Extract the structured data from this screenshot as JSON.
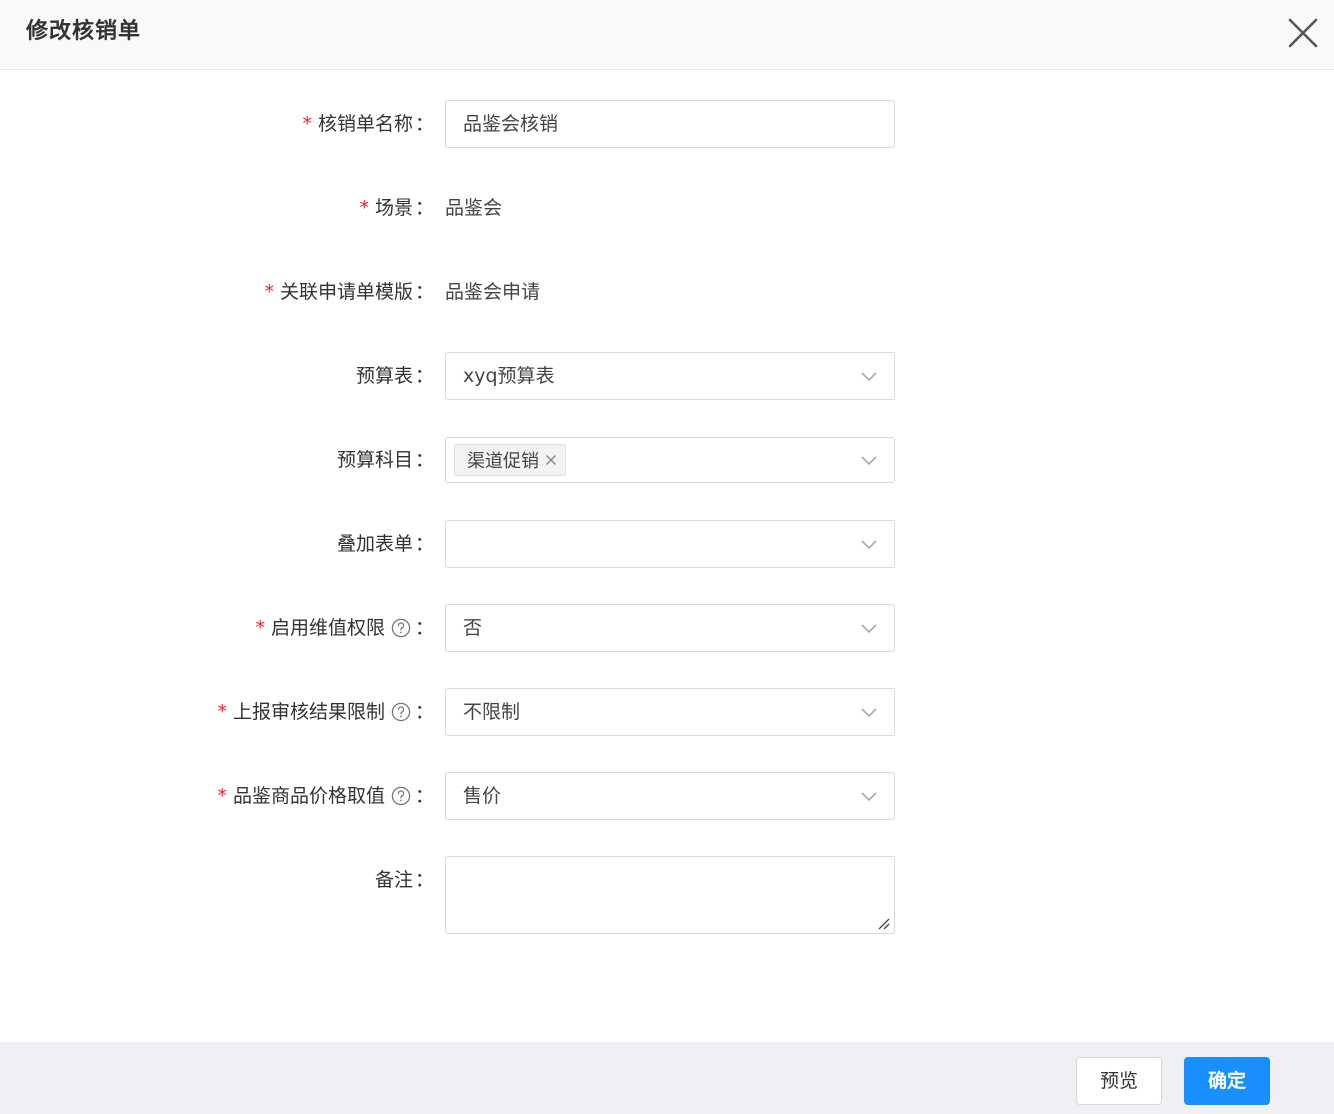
{
  "dialog": {
    "title": "修改核销单",
    "close_icon": "close-icon"
  },
  "colors": {
    "primary": "#1890ff",
    "required": "#f5222d",
    "border": "#d9d9d9"
  },
  "form": {
    "name": {
      "label": "核销单名称",
      "required": true,
      "value": "品鉴会核销"
    },
    "scene": {
      "label": "场景",
      "required": true,
      "value": "品鉴会"
    },
    "template": {
      "label": "关联申请单模版",
      "required": true,
      "value": "品鉴会申请"
    },
    "budget_table": {
      "label": "预算表",
      "required": false,
      "value": "xyq预算表"
    },
    "budget_subject": {
      "label": "预算科目",
      "required": false,
      "tags": [
        "渠道促销"
      ]
    },
    "overlay_form": {
      "label": "叠加表单",
      "required": false,
      "value": ""
    },
    "dimension_permission": {
      "label": "启用维值权限",
      "required": true,
      "value": "否",
      "help_icon": "question-circle-icon"
    },
    "audit_limit": {
      "label": "上报审核结果限制",
      "required": true,
      "value": "不限制",
      "help_icon": "question-circle-icon"
    },
    "price_value": {
      "label": "品鉴商品价格取值",
      "required": true,
      "value": "售价",
      "help_icon": "question-circle-icon"
    },
    "remark": {
      "label": "备注",
      "required": false,
      "value": ""
    }
  },
  "footer": {
    "preview_label": "预览",
    "confirm_label": "确定"
  }
}
